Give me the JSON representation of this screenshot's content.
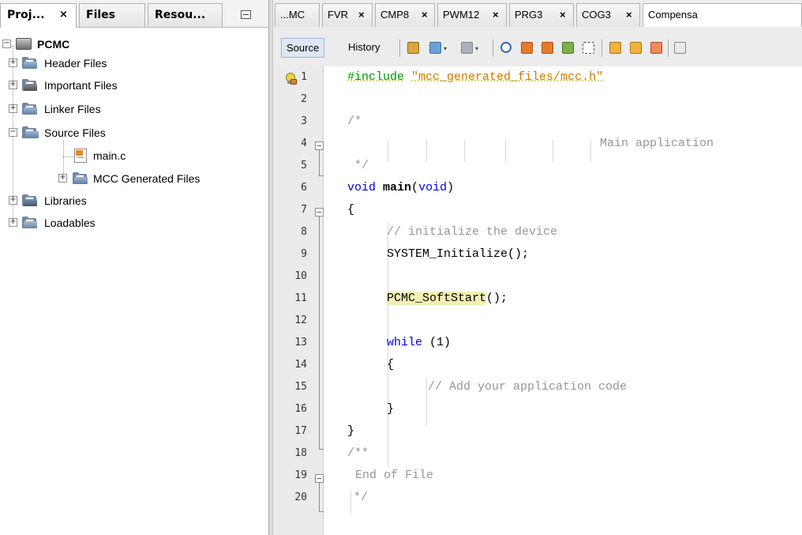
{
  "left_tabs": [
    {
      "label": "Proj...",
      "close": "×"
    },
    {
      "label": "Files",
      "close": ""
    },
    {
      "label": "Resou...",
      "close": ""
    }
  ],
  "tree": {
    "root": "PCMC",
    "items": [
      {
        "label": "Header Files",
        "icon": "folder-icon"
      },
      {
        "label": "Important Files",
        "icon": "folder-important-icon"
      },
      {
        "label": "Linker Files",
        "icon": "folder-icon"
      },
      {
        "label": "Source Files",
        "icon": "folder-open-icon"
      },
      {
        "label": "main.c",
        "icon": "c-source-file-icon"
      },
      {
        "label": "MCC Generated Files",
        "icon": "folder-icon"
      },
      {
        "label": "Libraries",
        "icon": "folder-library-icon"
      },
      {
        "label": "Loadables",
        "icon": "folder-loadables-icon"
      }
    ],
    "expand_plus": "+",
    "expand_minus": "−"
  },
  "editor_tabs": [
    {
      "label": "...MC",
      "close": ""
    },
    {
      "label": "FVR",
      "close": "×"
    },
    {
      "label": "CMP8",
      "close": "×"
    },
    {
      "label": "PWM12",
      "close": "×"
    },
    {
      "label": "PRG3",
      "close": "×"
    },
    {
      "label": "COG3",
      "close": "×"
    },
    {
      "label": "Compensa",
      "close": ""
    }
  ],
  "toolbar": {
    "source_label": "Source",
    "history_label": "History"
  },
  "line_numbers": [
    "1",
    "2",
    "3",
    "4",
    "5",
    "6",
    "7",
    "8",
    "9",
    "10",
    "11",
    "12",
    "13",
    "14",
    "15",
    "16",
    "17",
    "18",
    "19",
    "20"
  ],
  "code": {
    "l1_directive": "#include",
    "l1_path": "\"mcc_generated_files/mcc.h\"",
    "l3": "/*",
    "l4": "Main application",
    "l5": " */",
    "l6_void": "void",
    "l6_main": "main",
    "l6_paren_open": "(",
    "l6_arg": "void",
    "l6_paren_close": ")",
    "l7": "{",
    "l8": "// initialize the device",
    "l9": "SYSTEM_Initialize();",
    "l11_fn": "PCMC_SoftStart",
    "l11_rest": "();",
    "l13_kw": "while",
    "l13_rest": " (1)",
    "l14": "{",
    "l15": "// Add your application code",
    "l16": "}",
    "l17": "}",
    "l18": "/**",
    "l19": "End of File",
    "l20": "*/"
  },
  "colors": {
    "keyword": "#0000e6",
    "string": "#ce7b00",
    "comment": "#969696",
    "directive": "#009900",
    "highlight": "#f3efb3"
  }
}
